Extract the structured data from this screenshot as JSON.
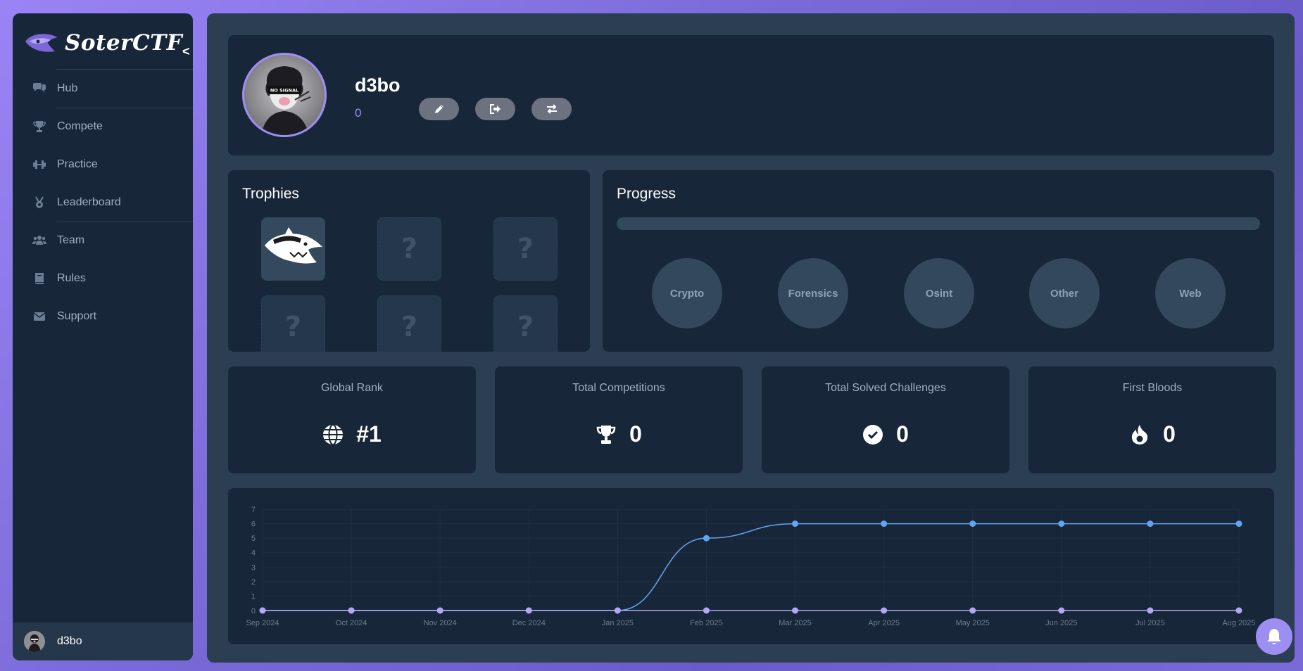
{
  "brand": {
    "name": "SoterCTF",
    "collapse": "<"
  },
  "nav": {
    "items": [
      {
        "label": "Hub",
        "icon": "comments-icon"
      },
      {
        "label": "Compete",
        "icon": "trophy-icon"
      },
      {
        "label": "Practice",
        "icon": "dumbbell-icon"
      },
      {
        "label": "Leaderboard",
        "icon": "medal-icon"
      },
      {
        "label": "Team",
        "icon": "users-icon"
      },
      {
        "label": "Rules",
        "icon": "book-icon"
      },
      {
        "label": "Support",
        "icon": "envelope-icon"
      }
    ]
  },
  "user": {
    "name": "d3bo",
    "score": "0",
    "avatar_text": "NO SIGNAL"
  },
  "profile_actions": [
    "edit-icon",
    "logout-icon",
    "switch-icon"
  ],
  "trophies": {
    "title": "Trophies",
    "items": [
      {
        "state": "earned",
        "icon": "shark-trophy-icon"
      },
      {
        "state": "locked",
        "label": "?"
      },
      {
        "state": "locked",
        "label": "?"
      },
      {
        "state": "locked",
        "label": "?"
      },
      {
        "state": "locked",
        "label": "?"
      },
      {
        "state": "locked",
        "label": "?"
      }
    ]
  },
  "progress": {
    "title": "Progress",
    "value": 0,
    "categories": [
      "Crypto",
      "Forensics",
      "Osint",
      "Other",
      "Web"
    ]
  },
  "stats": [
    {
      "label": "Global Rank",
      "value": "#1",
      "icon": "globe-icon"
    },
    {
      "label": "Total Competitions",
      "value": "0",
      "icon": "trophy-icon"
    },
    {
      "label": "Total Solved Challenges",
      "value": "0",
      "icon": "check-circle-icon"
    },
    {
      "label": "First Bloods",
      "value": "0",
      "icon": "fire-icon"
    }
  ],
  "colors": {
    "accent": "#9d8ff2",
    "line_blue": "#63a4f2",
    "line_purple": "#b3a6f7",
    "card_bg": "#172638",
    "panel_bg": "#2c3e51"
  },
  "chart_data": {
    "type": "line",
    "categories": [
      "Sep 2024",
      "Oct 2024",
      "Nov 2024",
      "Dec 2024",
      "Jan 2025",
      "Feb 2025",
      "Mar 2025",
      "Apr 2025",
      "May 2025",
      "Jun 2025",
      "Jul 2025",
      "Aug 2025"
    ],
    "series": [
      {
        "values": [
          0,
          0,
          0,
          0,
          0,
          5,
          6,
          6,
          6,
          6,
          6,
          6
        ],
        "color": "#63a4f2"
      },
      {
        "values": [
          0,
          0,
          0,
          0,
          0,
          0,
          0,
          0,
          0,
          0,
          0,
          0
        ],
        "color": "#b3a6f7"
      }
    ],
    "ylim": [
      0,
      7
    ],
    "yticks": [
      0,
      1,
      2,
      3,
      4,
      5,
      6,
      7
    ],
    "grid": true,
    "legend": "none"
  }
}
